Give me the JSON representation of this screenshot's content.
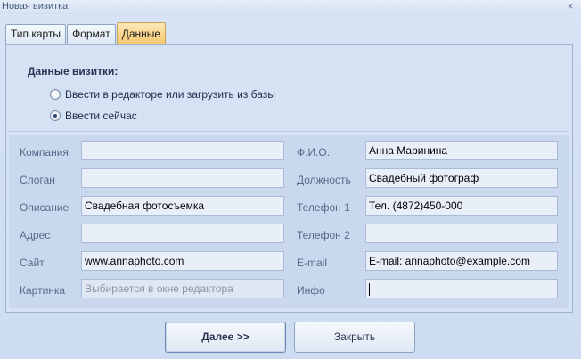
{
  "window": {
    "title": "Новая визитка",
    "close_glyph": "×"
  },
  "tabs": [
    {
      "label": "Тип карты",
      "active": false
    },
    {
      "label": "Формат",
      "active": false
    },
    {
      "label": "Данные",
      "active": true
    }
  ],
  "section": {
    "title": "Данные визитки:",
    "options": [
      {
        "label": "Ввести в редакторе или загрузить из базы",
        "checked": false
      },
      {
        "label": "Ввести сейчас",
        "checked": true
      }
    ]
  },
  "fields_left": [
    {
      "label": "Компания",
      "value": ""
    },
    {
      "label": "Слоган",
      "value": ""
    },
    {
      "label": "Описание",
      "value": "Свадебная фотосъемка"
    },
    {
      "label": "Адрес",
      "value": ""
    },
    {
      "label": "Сайт",
      "value": "www.annaphoto.com"
    },
    {
      "label": "Картинка",
      "value": "Выбирается в окне редактора",
      "disabled": true
    }
  ],
  "fields_right": [
    {
      "label": "Ф.И.О.",
      "value": "Анна Маринина"
    },
    {
      "label": "Должность",
      "value": "Свадебный фотограф"
    },
    {
      "label": "Телефон 1",
      "value": "Тел. (4872)450-000"
    },
    {
      "label": "Телефон 2",
      "value": ""
    },
    {
      "label": "E-mail",
      "value": "E-mail: annaphoto@example.com"
    },
    {
      "label": "Инфо",
      "value": ""
    }
  ],
  "buttons": {
    "next": "Далее >>",
    "close": "Закрыть"
  }
}
